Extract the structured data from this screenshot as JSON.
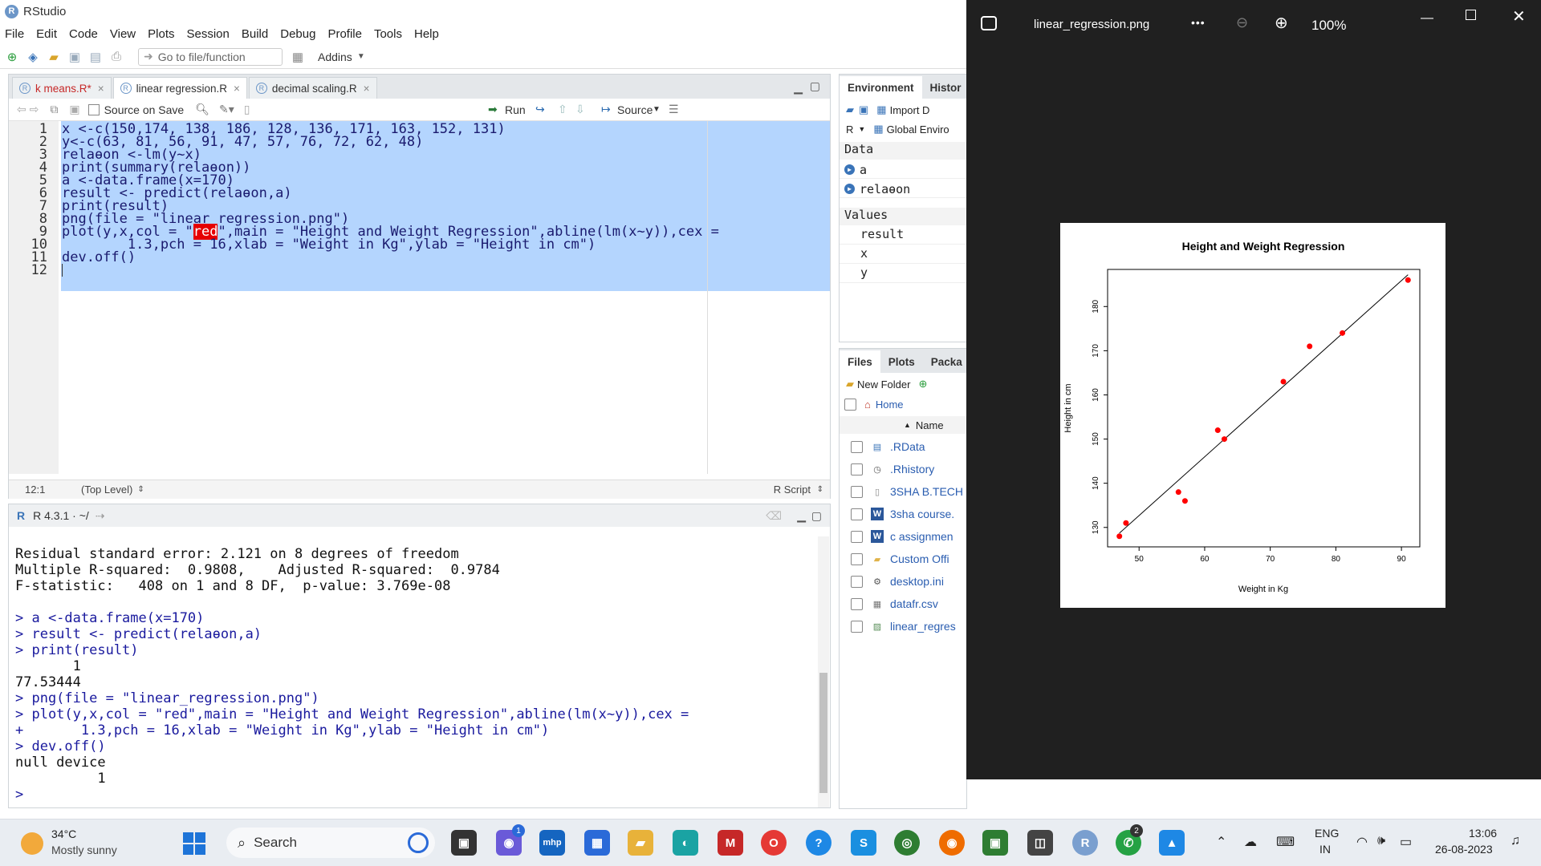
{
  "app": {
    "title": "RStudio"
  },
  "menu": [
    "File",
    "Edit",
    "Code",
    "View",
    "Plots",
    "Session",
    "Build",
    "Debug",
    "Profile",
    "Tools",
    "Help"
  ],
  "toolbar": {
    "goto_placeholder": "Go to file/function",
    "addins": "Addins"
  },
  "source": {
    "tabs": [
      {
        "label": "k means.R*",
        "modified": true
      },
      {
        "label": "linear regression.R",
        "modified": false
      },
      {
        "label": "decimal scaling.R",
        "modified": false
      }
    ],
    "source_on_save": "Source on Save",
    "run": "Run",
    "source_btn": "Source",
    "lines": [
      "x <-c(150,174, 138, 186, 128, 136, 171, 163, 152, 131)",
      "y<-c(63, 81, 56, 91, 47, 57, 76, 72, 62, 48)",
      "relaɵon <-lm(y~x)",
      "print(summary(relaɵon))",
      "a <-data.frame(x=170)",
      "result <- predict(relaɵon,a)",
      "print(result)",
      "png(file = \"linear_regression.png\")",
      "plot(y,x,col = \"red\",main = \"Height and Weight Regression\",abline(lm(x~y)),cex =",
      "        1.3,pch = 16,xlab = \"Weight in Kg\",ylab = \"Height in cm\")",
      "dev.off()",
      ""
    ],
    "line9_pre": "plot(y,x,col = \"",
    "line9_hl": "red",
    "line9_post": "\",main = \"Height and Weight Regression\",abline(lm(x~y)),cex =",
    "status_pos": "12:1",
    "status_scope": "(Top Level)",
    "status_type": "R Script"
  },
  "console": {
    "header": "R 4.3.1 · ~/",
    "lines": [
      {
        "t": "Residual standard error: 2.121 on 8 degrees of freedom",
        "cmd": false
      },
      {
        "t": "Multiple R-squared:  0.9808,    Adjusted R-squared:  0.9784",
        "cmd": false
      },
      {
        "t": "F-statistic:   408 on 1 and 8 DF,  p-value: 3.769e-08",
        "cmd": false
      },
      {
        "t": "",
        "cmd": false
      },
      {
        "t": "> a <-data.frame(x=170)",
        "cmd": true
      },
      {
        "t": "> result <- predict(relaɵon,a)",
        "cmd": true
      },
      {
        "t": "> print(result)",
        "cmd": true
      },
      {
        "t": "       1",
        "cmd": false
      },
      {
        "t": "77.53444",
        "cmd": false
      },
      {
        "t": "> png(file = \"linear_regression.png\")",
        "cmd": true
      },
      {
        "t": "> plot(y,x,col = \"red\",main = \"Height and Weight Regression\",abline(lm(x~y)),cex =",
        "cmd": true
      },
      {
        "t": "+       1.3,pch = 16,xlab = \"Weight in Kg\",ylab = \"Height in cm\")",
        "cmd": true
      },
      {
        "t": "> dev.off()",
        "cmd": true
      },
      {
        "t": "null device",
        "cmd": false
      },
      {
        "t": "          1",
        "cmd": false
      },
      {
        "t": "> ",
        "cmd": true
      }
    ]
  },
  "environment": {
    "tabs": [
      "Environment",
      "Histor"
    ],
    "import": "Import D",
    "lang": "R",
    "scope": "Global Enviro",
    "data_header": "Data",
    "data": [
      "a",
      "relaɵon"
    ],
    "values_header": "Values",
    "values": [
      "result",
      "x",
      "y"
    ]
  },
  "files": {
    "tabs": [
      "Files",
      "Plots",
      "Packa"
    ],
    "new_folder": "New Folder",
    "home": "Home",
    "name_col": "Name",
    "items": [
      {
        "name": ".RData",
        "icon": "rdata-icon"
      },
      {
        "name": ".Rhistory",
        "icon": "rhistory-icon"
      },
      {
        "name": "3SHA B.TECH",
        "icon": "file-icon"
      },
      {
        "name": "3sha course.",
        "icon": "word-icon"
      },
      {
        "name": "c assignmen",
        "icon": "word-icon"
      },
      {
        "name": "Custom Offi",
        "icon": "folder-icon"
      },
      {
        "name": "desktop.ini",
        "icon": "settings-file-icon"
      },
      {
        "name": "datafr.csv",
        "icon": "csv-icon"
      },
      {
        "name": "linear_regres",
        "icon": "image-file-icon"
      }
    ]
  },
  "viewer": {
    "filename": "linear_regression.png",
    "more": "•••",
    "zoom": "100%"
  },
  "chart_data": {
    "type": "scatter",
    "title": "Height and Weight Regression",
    "xlabel": "Weight in Kg",
    "ylabel": "Height in cm",
    "x": [
      63,
      81,
      56,
      91,
      47,
      57,
      76,
      72,
      62,
      48
    ],
    "y": [
      150,
      174,
      138,
      186,
      128,
      136,
      171,
      163,
      152,
      131
    ],
    "xticks": [
      50,
      60,
      70,
      80,
      90
    ],
    "yticks": [
      130,
      140,
      150,
      160,
      170,
      180
    ],
    "xlim": [
      45.2,
      92.8
    ],
    "ylim": [
      125.6,
      188.4
    ],
    "point_color": "#ff0000",
    "regression_line": {
      "x1": 47,
      "y1": 128.7,
      "x2": 91,
      "y2": 187.2
    }
  },
  "taskbar": {
    "weather_temp": "34°C",
    "weather_desc": "Mostly sunny",
    "search": "Search",
    "lang1": "ENG",
    "lang2": "IN",
    "time": "13:06",
    "date": "26-08-2023",
    "badge_chat": "1",
    "badge_whatsapp": "2"
  }
}
